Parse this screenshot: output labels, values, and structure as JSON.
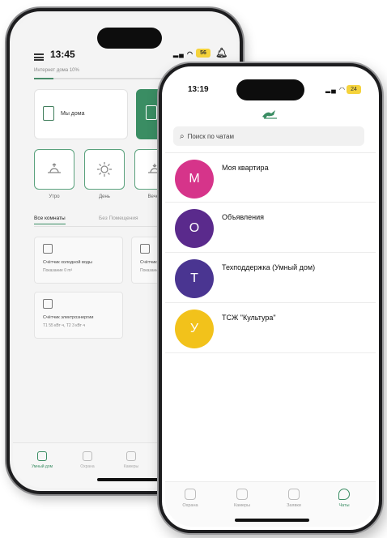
{
  "back_phone": {
    "status": {
      "time": "13:45",
      "battery": "56"
    },
    "internet_progress": {
      "label": "Интернет дома 10%",
      "fraction": 0.1
    },
    "cards": {
      "home_label": "Мы дома"
    },
    "scenarios": [
      {
        "label": "Утро",
        "icon": "sunrise-icon"
      },
      {
        "label": "День",
        "icon": "sun-icon"
      },
      {
        "label": "Вечер",
        "icon": "sunset-icon"
      }
    ],
    "tabs": [
      {
        "label": "Все комнаты",
        "active": true
      },
      {
        "label": "Без Помещения",
        "active": false
      }
    ],
    "devices": [
      {
        "title": "Счётчик холодной воды",
        "subtitle": "Показание 0 m³"
      },
      {
        "title": "Счётчик",
        "subtitle": "Показание"
      },
      {
        "title": "Счётчик электроэнергии",
        "subtitle": "Т1 55 кВт·ч, Т2 3 кВт·ч"
      }
    ],
    "nav": [
      {
        "label": "Умный дом",
        "active": true
      },
      {
        "label": "Охрана",
        "active": false
      },
      {
        "label": "Камеры",
        "active": false
      }
    ]
  },
  "front_phone": {
    "status": {
      "time": "13:19",
      "battery": "24"
    },
    "search": {
      "placeholder": "Поиск по чатам"
    },
    "chats": [
      {
        "initial": "М",
        "name": "Моя квартира",
        "color": "#d6348a"
      },
      {
        "initial": "О",
        "name": "Объявления",
        "color": "#5a2a8c"
      },
      {
        "initial": "Т",
        "name": "Техподдержка (Умный дом)",
        "color": "#4a3591"
      },
      {
        "initial": "У",
        "name": "ТСЖ \"Культура\"",
        "color": "#f2c21b"
      }
    ],
    "nav": [
      {
        "label": "Охрана",
        "active": false
      },
      {
        "label": "Камеры",
        "active": false
      },
      {
        "label": "Заявки",
        "active": false
      },
      {
        "label": "Чаты",
        "active": true
      }
    ]
  },
  "colors": {
    "accent": "#3a8d63",
    "battery": "#f5d33c"
  }
}
